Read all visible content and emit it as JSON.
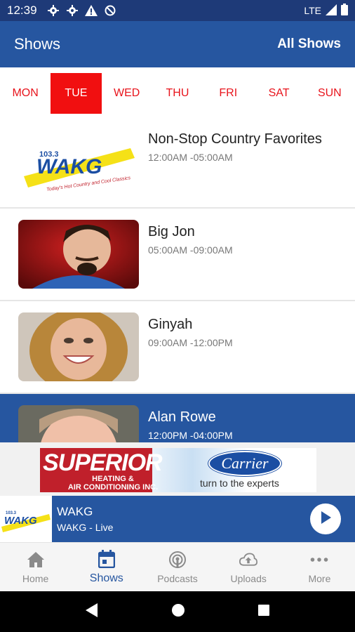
{
  "status_bar": {
    "time": "12:39",
    "network": "LTE"
  },
  "app_bar": {
    "title": "Shows",
    "all_shows_label": "All Shows"
  },
  "days": [
    "MON",
    "TUE",
    "WED",
    "THU",
    "FRI",
    "SAT",
    "SUN"
  ],
  "selected_day": "TUE",
  "shows": [
    {
      "name": "Non-Stop Country Favorites",
      "time": "12:00AM -05:00AM"
    },
    {
      "name": "Big Jon",
      "time": "05:00AM -09:00AM"
    },
    {
      "name": "Ginyah",
      "time": "09:00AM -12:00PM"
    },
    {
      "name": "Alan Rowe",
      "time": "12:00PM -04:00PM"
    }
  ],
  "station_logo": {
    "freq": "103.3",
    "call": "WAKG",
    "tagline": "Today's Hot Country and Cool Classics"
  },
  "ad": {
    "brand": "SUPERIOR",
    "subline1": "HEATING &",
    "subline2": "AIR CONDITIONING INC.",
    "partner": "Carrier",
    "tagline": "turn to the experts"
  },
  "player": {
    "title": "WAKG",
    "subtitle": "WAKG - Live"
  },
  "bottom_nav": [
    {
      "label": "Home",
      "icon": "home-icon"
    },
    {
      "label": "Shows",
      "icon": "calendar-icon"
    },
    {
      "label": "Podcasts",
      "icon": "podcast-icon"
    },
    {
      "label": "Uploads",
      "icon": "cloud-upload-icon"
    },
    {
      "label": "More",
      "icon": "more-dots-icon"
    }
  ],
  "active_nav": "Shows",
  "colors": {
    "primary": "#2656a0",
    "status_bar": "#1e3a78",
    "day_red": "#e8141c",
    "selected_day_bg": "#f10f10"
  }
}
